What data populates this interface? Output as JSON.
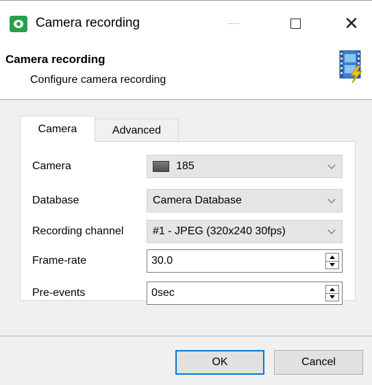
{
  "window": {
    "title": "Camera recording"
  },
  "header": {
    "title": "Camera recording",
    "subtitle": "Configure camera recording",
    "icon": "film-lightning-icon"
  },
  "tabs": [
    {
      "label": "Camera",
      "selected": true
    },
    {
      "label": "Advanced",
      "selected": false
    }
  ],
  "form": {
    "camera": {
      "label": "Camera",
      "value": "185"
    },
    "database": {
      "label": "Database",
      "value": "Camera Database"
    },
    "recording_channel": {
      "label": "Recording channel",
      "value": "#1 - JPEG (320x240 30fps)"
    },
    "frame_rate": {
      "label": "Frame-rate",
      "value": "30.0"
    },
    "pre_events": {
      "label": "Pre-events",
      "value": "0sec"
    }
  },
  "buttons": {
    "ok": "OK",
    "cancel": "Cancel"
  },
  "colors": {
    "app_icon": "#2aa14b",
    "focus_border": "#0078d7"
  }
}
